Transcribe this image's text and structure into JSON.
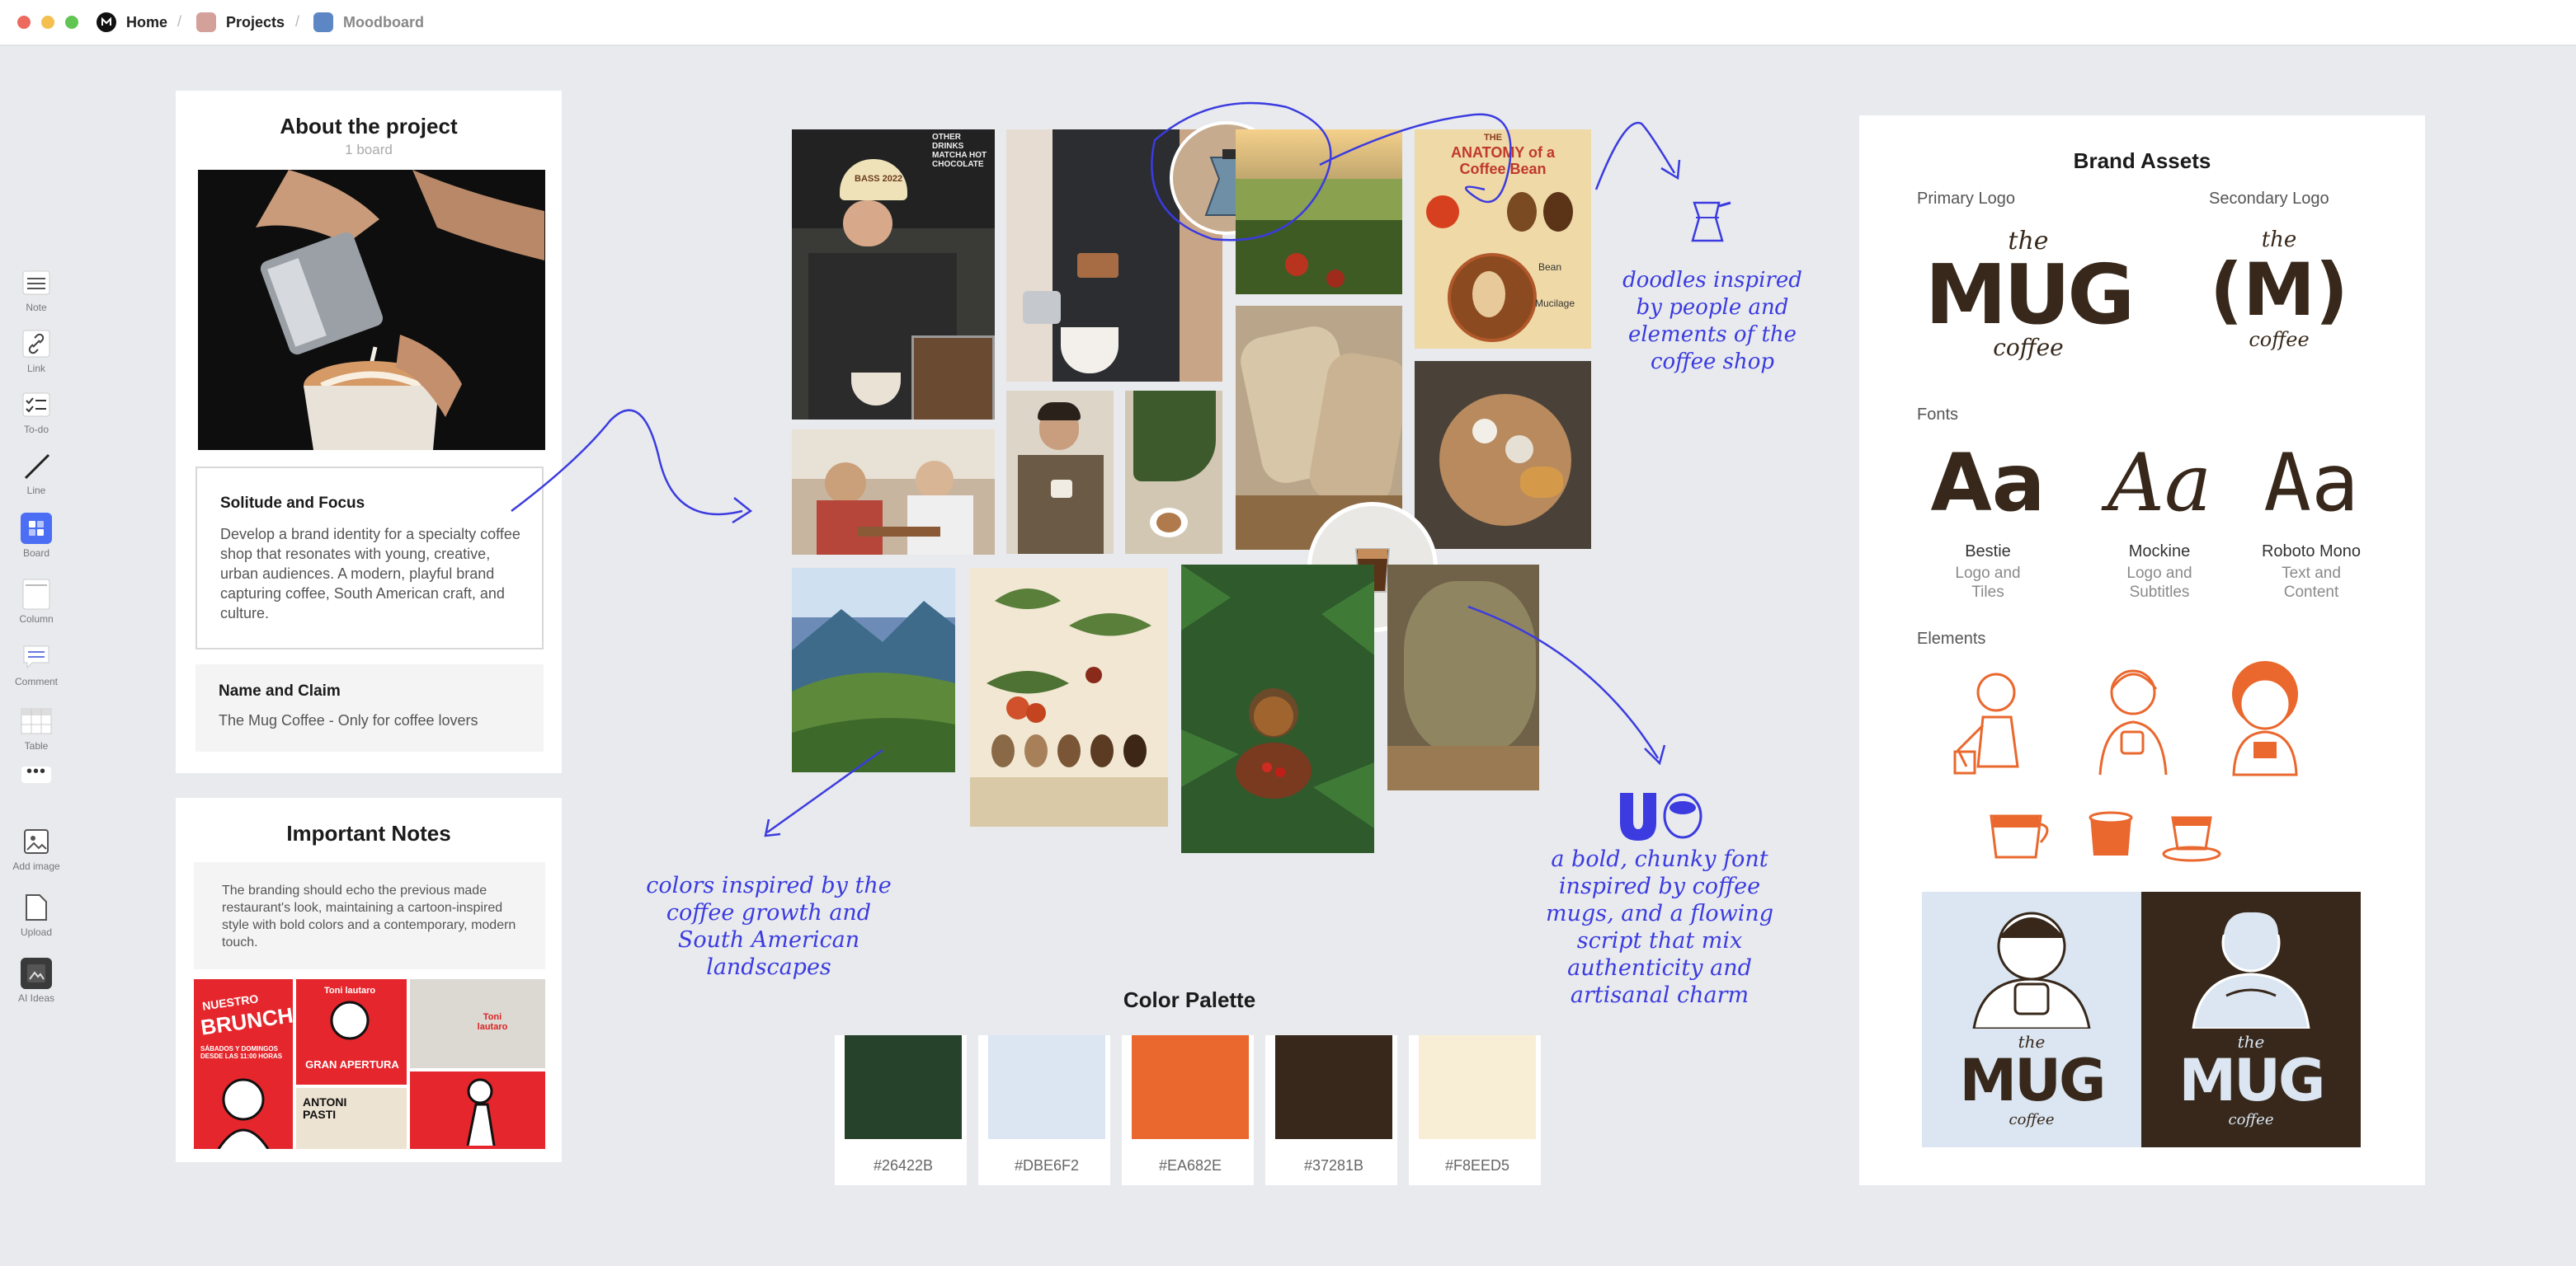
{
  "breadcrumb": {
    "home": "Home",
    "projects": "Projects",
    "moodboard": "Moodboard"
  },
  "colors": {
    "accent": "#3B3BE0",
    "board_blue": "#4C6EF5",
    "dark_green": "#26422B",
    "light_blue": "#DBE6F2",
    "orange": "#EA682E",
    "dark_brown": "#37281B",
    "cream": "#F8EED5"
  },
  "toolbar": [
    {
      "label": "Note",
      "icon": "note-icon"
    },
    {
      "label": "Link",
      "icon": "link-icon"
    },
    {
      "label": "To-do",
      "icon": "todo-icon"
    },
    {
      "label": "Line",
      "icon": "line-icon"
    },
    {
      "label": "Board",
      "icon": "board-icon"
    },
    {
      "label": "Column",
      "icon": "column-icon"
    },
    {
      "label": "Comment",
      "icon": "comment-icon"
    },
    {
      "label": "Table",
      "icon": "table-icon"
    },
    {
      "label": "",
      "icon": "more-icon"
    },
    {
      "label": "Add image",
      "icon": "add-image-icon"
    },
    {
      "label": "Upload",
      "icon": "upload-icon"
    },
    {
      "label": "AI Ideas",
      "icon": "ai-ideas-icon"
    }
  ],
  "about": {
    "title": "About the project",
    "subtitle": "1 board",
    "focus_title": "Solitude and Focus",
    "focus_text": "Develop a brand identity for a specialty coffee shop that resonates with young, creative, urban audiences. A modern, playful brand capturing coffee, South American craft, and culture.",
    "name_title": "Name and Claim",
    "name_text": "The Mug Coffee - Only for coffee lovers"
  },
  "notes": {
    "title": "Important Notes",
    "text": "The branding should echo the previous made restaurant's look, maintaining a cartoon-inspired style with bold colors and a contemporary, modern touch."
  },
  "poster_texts": {
    "brunch_top": "NUESTRO",
    "brunch": "BRUNCH",
    "brunch_sub": "SÁBADOS Y DOMINGOS DESDE LAS 11:00 HORAS",
    "toni1": "Toni lautaro",
    "apertura": "GRAN APERTURA",
    "toni2": "Toni lautaro",
    "antoni": "ANTONI PASTI"
  },
  "annotations": {
    "doodles": "doodles inspired by people and elements of the coffee shop",
    "colors": "colors inspired by the coffee growth and South American landscapes",
    "font": "a bold, chunky font inspired by coffee mugs, and a flowing script that mix authenticity and artisanal charm"
  },
  "photo_texts": {
    "cap": "BASS 2022",
    "menu": "OTHER DRINKS MATCHA HOT CHOCOLATE",
    "anatomy_top": "THE",
    "anatomy_title": "ANATOMY of a Coffee Bean",
    "anatomy_label1": "Bean",
    "anatomy_label2": "Mucilage"
  },
  "palette": {
    "title": "Color Palette",
    "swatches": [
      {
        "hex": "#26422B",
        "label": "#26422B"
      },
      {
        "hex": "#DBE6F2",
        "label": "#DBE6F2"
      },
      {
        "hex": "#EA682E",
        "label": "#EA682E"
      },
      {
        "hex": "#37281B",
        "label": "#37281B"
      },
      {
        "hex": "#F8EED5",
        "label": "#F8EED5"
      }
    ]
  },
  "brand": {
    "title": "Brand Assets",
    "primary_logo": "Primary Logo",
    "secondary_logo": "Secondary Logo",
    "logo_the": "the",
    "logo_mug": "MUG",
    "logo_coffee": "coffee",
    "logo_m": "(M)",
    "fonts_label": "Fonts",
    "fonts": [
      {
        "sample": "Aa",
        "name": "Bestie",
        "use": "Logo and Tiles"
      },
      {
        "sample": "Aa",
        "name": "Mockine",
        "use": "Logo and Subtitles"
      },
      {
        "sample": "Aa",
        "name": "Roboto Mono",
        "use": "Text and Content"
      }
    ],
    "elements_label": "Elements"
  }
}
